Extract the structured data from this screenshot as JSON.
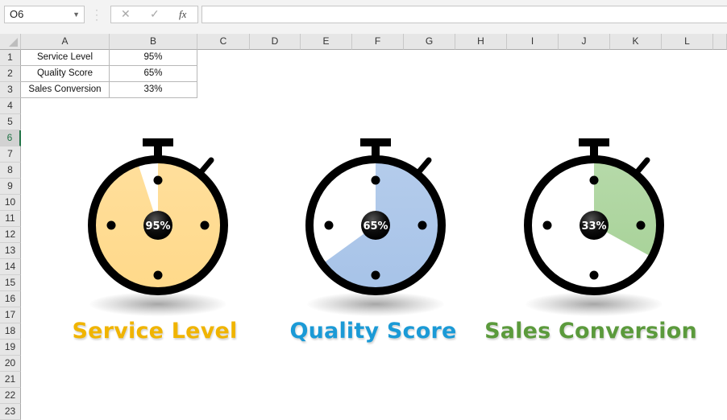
{
  "toolbar": {
    "name_box": "O6",
    "cancel_icon": "✕",
    "enter_icon": "✓",
    "fx_label": "fx",
    "formula_value": ""
  },
  "columns": [
    "A",
    "B",
    "C",
    "D",
    "E",
    "F",
    "G",
    "H",
    "I",
    "J",
    "K",
    "L"
  ],
  "rows": [
    "1",
    "2",
    "3",
    "4",
    "5",
    "6",
    "7",
    "8",
    "9",
    "10",
    "11",
    "12",
    "13",
    "14",
    "15",
    "16",
    "17",
    "18",
    "19",
    "20",
    "21",
    "22",
    "23"
  ],
  "selected_row": "6",
  "table": [
    {
      "label": "Service Level",
      "value": "95%"
    },
    {
      "label": "Quality Score",
      "value": "65%"
    },
    {
      "label": "Sales Conversion",
      "value": "33%"
    }
  ],
  "chart_data": [
    {
      "type": "pie",
      "title": "Service Level",
      "value_pct": 95,
      "display": "95%",
      "fill_color": "#ffd98a",
      "label_color": "#f0b400"
    },
    {
      "type": "pie",
      "title": "Quality Score",
      "value_pct": 65,
      "display": "65%",
      "fill_color": "#a7c3e8",
      "label_color": "#1b9ad6"
    },
    {
      "type": "pie",
      "title": "Sales Conversion",
      "value_pct": 33,
      "display": "33%",
      "fill_color": "#a9d39a",
      "label_color": "#5b9a3c"
    }
  ]
}
